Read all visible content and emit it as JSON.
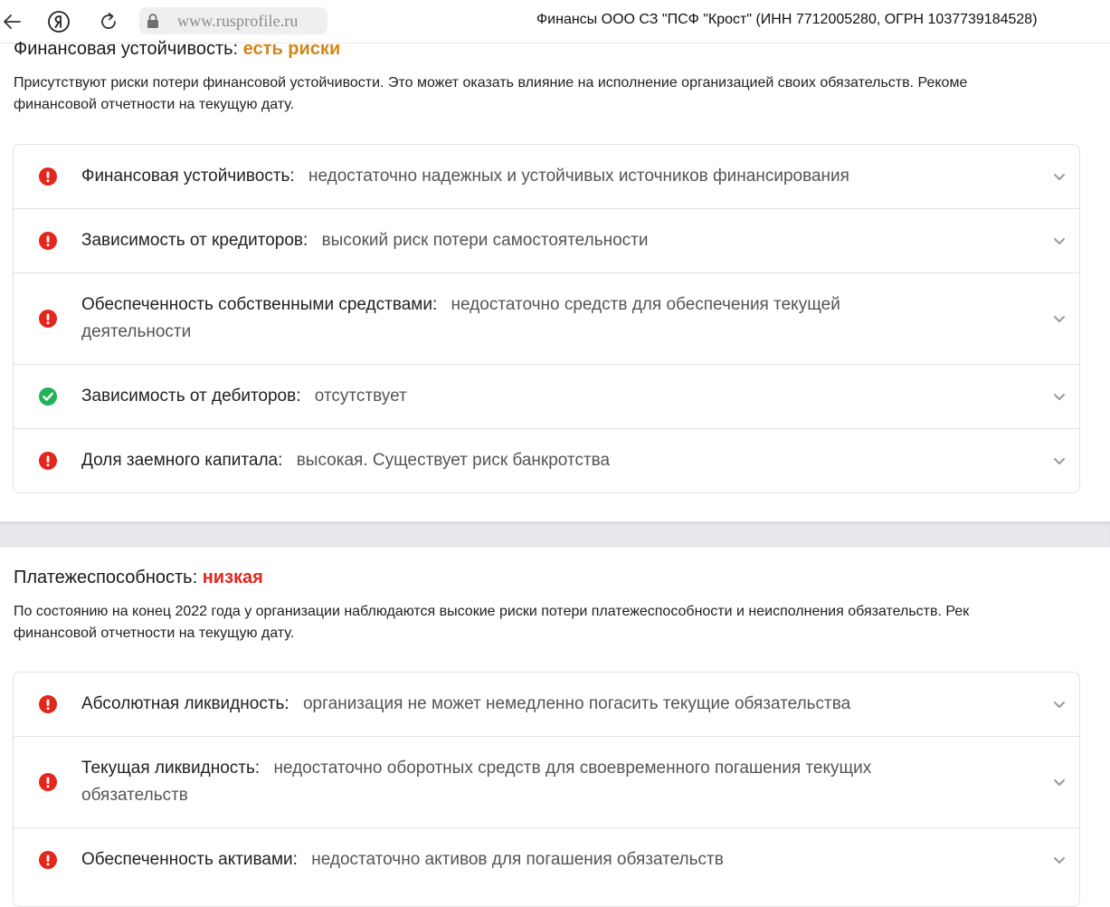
{
  "browser": {
    "url": "www.rusprofile.ru",
    "tab_title": "Финансы ООО СЗ \"ПСФ \"Крост\" (ИНН 7712005280, ОГРН 1037739184528)"
  },
  "sections": [
    {
      "title": "Финансовая устойчивость:",
      "status": "есть риски",
      "status_color": "#d58519",
      "description": "Присутствуют риски потери финансовой устойчивости. Это может оказать влияние на исполнение организацией своих обязательств. Рекоме",
      "description_line2": "финансовой отчетности на текущую дату.",
      "items": [
        {
          "icon": "alert-icon",
          "label": "Финансовая устойчивость:",
          "value": "недостаточно надежных и устойчивых источников финансирования"
        },
        {
          "icon": "alert-icon",
          "label": "Зависимость от кредиторов:",
          "value": "высокий риск потери самостоятельности"
        },
        {
          "icon": "alert-icon",
          "label": "Обеспеченность собственными средствами:",
          "value": "недостаточно средств для обеспечения текущей деятельности"
        },
        {
          "icon": "check-icon",
          "label": "Зависимость от дебиторов:",
          "value": "отсутствует"
        },
        {
          "icon": "alert-icon",
          "label": "Доля заемного капитала:",
          "value": "высокая. Существует риск банкротства"
        }
      ]
    },
    {
      "title": "Платежеспособность:",
      "status": "низкая",
      "status_color": "#e5261b",
      "description": "По состоянию на конец 2022 года у организации наблюдаются высокие риски потери платежеспособности и неисполнения обязательств. Рек",
      "description_line2": "финансовой отчетности на текущую дату.",
      "items": [
        {
          "icon": "alert-icon",
          "label": "Абсолютная ликвидность:",
          "value": "организация не может немедленно погасить текущие обязательства"
        },
        {
          "icon": "alert-icon",
          "label": "Текущая ликвидность:",
          "value": "недостаточно оборотных средств для своевременного погашения текущих обязательств"
        },
        {
          "icon": "alert-icon",
          "label": "Обеспеченность активами:",
          "value": "недостаточно активов для погашения обязательств"
        }
      ]
    }
  ],
  "colors": {
    "alert": "#e5261b",
    "ok": "#21b25a",
    "chevron": "#9a9a9a"
  }
}
